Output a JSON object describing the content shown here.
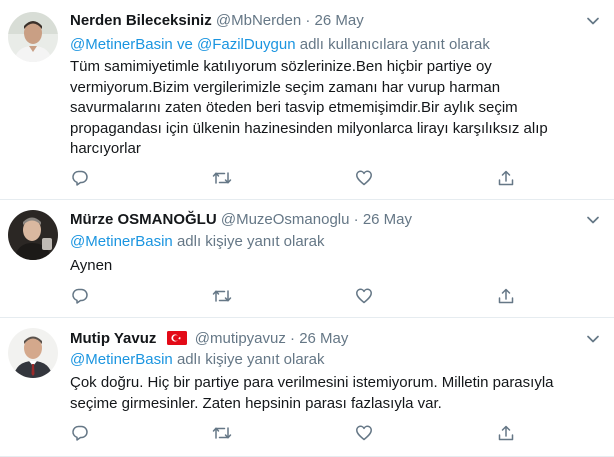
{
  "tweets": [
    {
      "name": "Nerden Bileceksiniz",
      "handle": "@MbNerden",
      "sep": "·",
      "date": "26 May",
      "reply_mentions_1": "@MetinerBasin",
      "reply_and": "ve",
      "reply_mentions_2": "@FazilDuygun",
      "reply_suffix": "adlı kullanıcılara yanıt olarak",
      "body_lines": [
        "Tüm samimiyetimle katılıyorum sözlerinize.Ben hiçbir partiye oy",
        "vermiyorum.Bizim vergilerimizle seçim zamanı har vurup harman",
        "savurmalarını zaten öteden beri tasvip etmemişimdir.Bir aylık seçim",
        "propagandası için ülkenin hazinesinden milyonlarca lirayı karşılıksız alıp",
        "harcıyorlar"
      ]
    },
    {
      "name": "Mürze OSMANOĞLU",
      "handle": "@MuzeOsmanoglu",
      "sep": "·",
      "date": "26 May",
      "reply_mentions_1": "@MetinerBasin",
      "reply_suffix": "adlı kişiye yanıt olarak",
      "body_lines": [
        "Aynen"
      ]
    },
    {
      "name": "Mutip Yavuz",
      "handle": "@mutipyavuz",
      "sep": "·",
      "date": "26 May",
      "reply_mentions_1": "@MetinerBasin",
      "reply_suffix": "adlı kişiye yanıt olarak",
      "body_lines": [
        "Çok doğru. Hiç bir partiye para verilmesini istemiyorum. Milletin parasıyla",
        "seçime girmesinler. Zaten hepsinin parası fazlasıyla var."
      ]
    }
  ],
  "icons": {
    "reply": "reply-icon",
    "retweet": "retweet-icon",
    "like": "heart-icon",
    "share": "share-icon",
    "more": "chevron-down-icon",
    "flag": "turkey-flag-icon"
  },
  "colors": {
    "mention": "#1b95e0",
    "meta": "#657786",
    "text": "#14171a",
    "divider": "#e6ecf0",
    "flag_red": "#e30a17"
  }
}
